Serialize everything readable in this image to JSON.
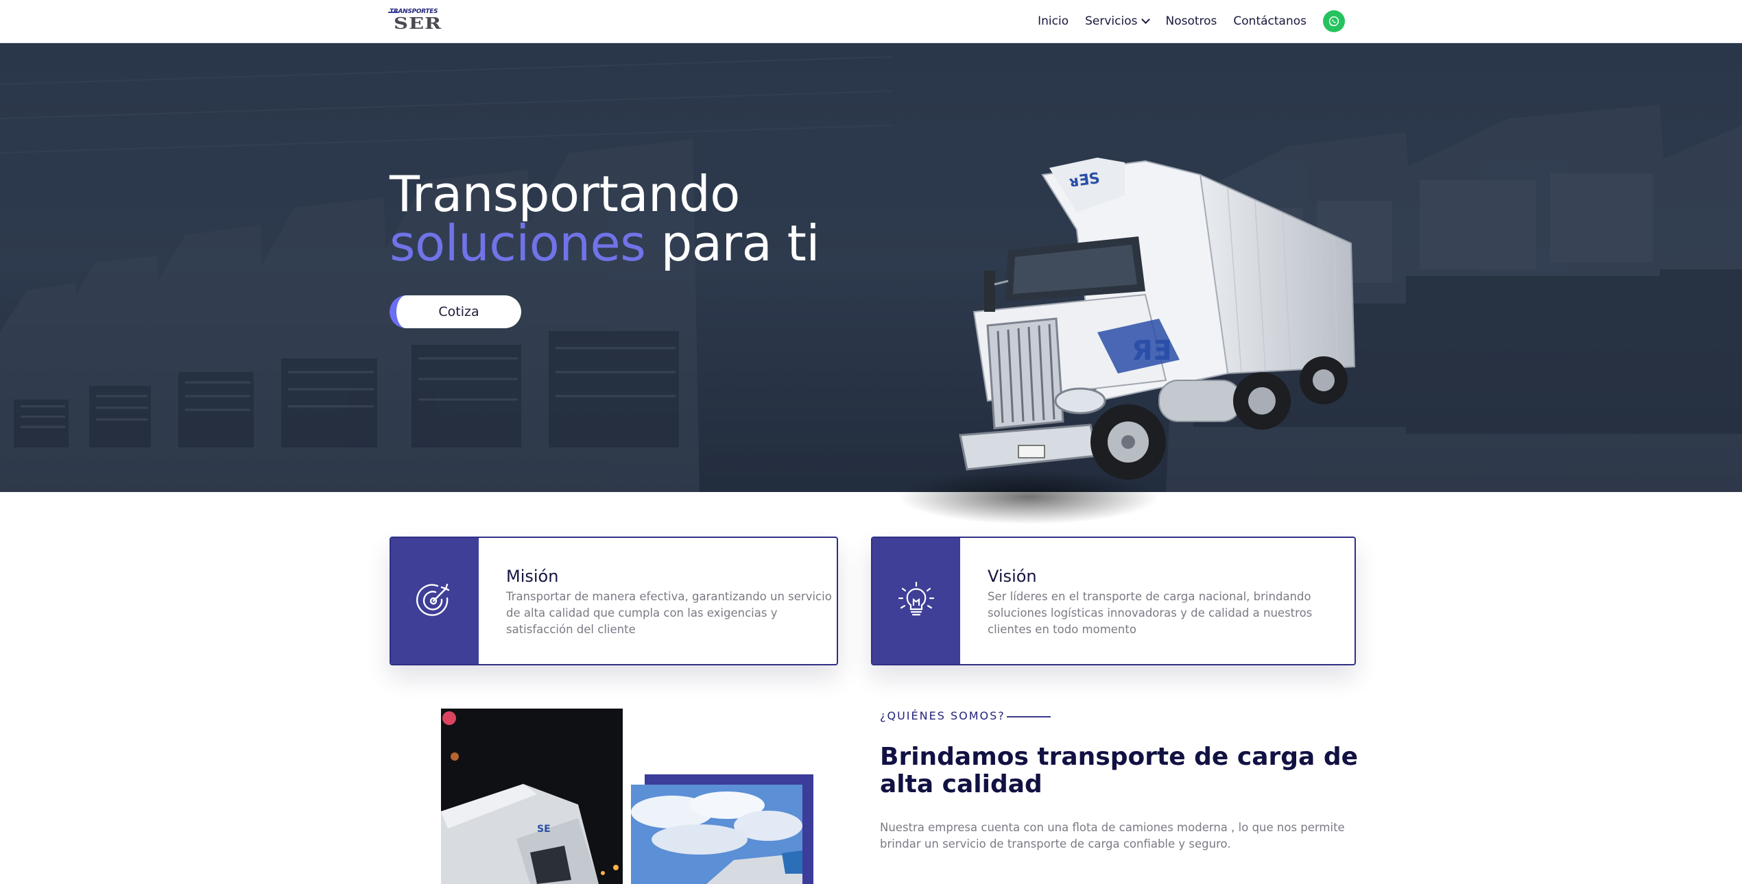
{
  "header": {
    "logo_top": "TRANSPORTES",
    "logo_main": "SER",
    "nav": [
      {
        "label": "Inicio"
      },
      {
        "label": "Servicios",
        "icon": "chevron-down-icon"
      },
      {
        "label": "Nosotros"
      },
      {
        "label": "Contáctanos"
      }
    ],
    "whatsapp_icon": "whatsapp-icon"
  },
  "hero": {
    "title_line1": "Transportando",
    "title_accent": "soluciones",
    "title_rest": " para ti",
    "cta_label": "Cotiza"
  },
  "cards": {
    "mision": {
      "icon": "target-icon",
      "title": "Misión",
      "text": "Transportar de manera efectiva, garantizando un servicio de alta calidad que cumpla con las exigencias y satisfacción del cliente"
    },
    "vision": {
      "icon": "lightbulb-icon",
      "title": "Visión",
      "text": "Ser líderes en el transporte de carga nacional, brindando soluciones logísticas innovadoras y de calidad a nuestros clientes en todo momento"
    }
  },
  "about": {
    "eyebrow": "¿QUIÉNES SOMOS?",
    "title": "Brindamos transporte de carga de alta calidad",
    "text": "Nuestra empresa cuenta con una flota de camiones moderna , lo que nos permite brindar un servicio de transporte de carga confiable y seguro."
  },
  "colors": {
    "accent": "#7173e8",
    "brand_navy": "#3f3f98",
    "whatsapp": "#25c35e"
  }
}
